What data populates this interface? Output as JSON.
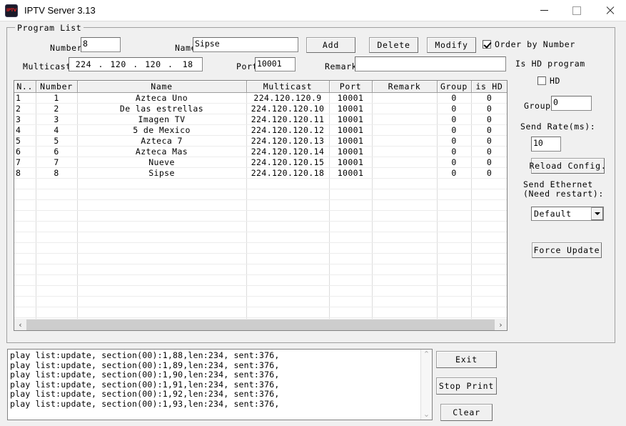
{
  "window": {
    "title": "IPTV Server 3.13",
    "icon": "iptv-logo-icon",
    "icon_text": "IPTV",
    "minimize": "—",
    "maximize": "□",
    "close": "✕"
  },
  "group": {
    "title": "Program List"
  },
  "form": {
    "number_label": "Number",
    "number_value": "8",
    "name_label": "Name",
    "name_value": "Sipse",
    "multicast_label": "Multicast",
    "multicast_octets": [
      "224",
      "120",
      "120",
      "18"
    ],
    "multicast_sep": ".",
    "port_label": "Port",
    "port_value": "10001",
    "remark_label": "Remark",
    "remark_value": ""
  },
  "actions": {
    "add": "Add",
    "delete": "Delete",
    "modify": "Modify",
    "order_by_number": "Order by Number",
    "order_by_number_checked": true
  },
  "hd_panel": {
    "title": "Is HD program",
    "hd_label": "HD",
    "hd_checked": false,
    "group_label": "Group",
    "group_value": "0"
  },
  "send_panel": {
    "rate_label": "Send Rate(ms):",
    "rate_value": "10",
    "reload_button": "Reload Config.",
    "ethernet_label_line1": "Send Ethernet",
    "ethernet_label_line2": "(Need restart):",
    "ethernet_value": "Default",
    "ethernet_options": [
      "Default"
    ],
    "force_update_button": "Force Update"
  },
  "table": {
    "columns": [
      "N..",
      "Number",
      "Name",
      "Multicast",
      "Port",
      "Remark",
      "Group",
      "is HD"
    ],
    "rows": [
      {
        "n": "1",
        "number": "1",
        "name": "Azteca Uno",
        "multicast": "224.120.120.9",
        "port": "10001",
        "remark": "",
        "group": "0",
        "is_hd": "0"
      },
      {
        "n": "2",
        "number": "2",
        "name": "De las estrellas",
        "multicast": "224.120.120.10",
        "port": "10001",
        "remark": "",
        "group": "0",
        "is_hd": "0"
      },
      {
        "n": "3",
        "number": "3",
        "name": "Imagen TV",
        "multicast": "224.120.120.11",
        "port": "10001",
        "remark": "",
        "group": "0",
        "is_hd": "0"
      },
      {
        "n": "4",
        "number": "4",
        "name": "5 de Mexico",
        "multicast": "224.120.120.12",
        "port": "10001",
        "remark": "",
        "group": "0",
        "is_hd": "0"
      },
      {
        "n": "5",
        "number": "5",
        "name": "Azteca 7",
        "multicast": "224.120.120.13",
        "port": "10001",
        "remark": "",
        "group": "0",
        "is_hd": "0"
      },
      {
        "n": "6",
        "number": "6",
        "name": "Azteca Mas",
        "multicast": "224.120.120.14",
        "port": "10001",
        "remark": "",
        "group": "0",
        "is_hd": "0"
      },
      {
        "n": "7",
        "number": "7",
        "name": "Nueve",
        "multicast": "224.120.120.15",
        "port": "10001",
        "remark": "",
        "group": "0",
        "is_hd": "0"
      },
      {
        "n": "8",
        "number": "8",
        "name": "Sipse",
        "multicast": "224.120.120.18",
        "port": "10001",
        "remark": "",
        "group": "0",
        "is_hd": "0"
      }
    ],
    "empty_row_count": 16,
    "scroll_left_arrow": "‹",
    "scroll_right_arrow": "›"
  },
  "log": {
    "lines": [
      "play list:update, section(00):1,88,len:234, sent:376,",
      "play list:update, section(00):1,89,len:234, sent:376,",
      "play list:update, section(00):1,90,len:234, sent:376,",
      "play list:update, section(00):1,91,len:234, sent:376,",
      "play list:update, section(00):1,92,len:234, sent:376,",
      "play list:update, section(00):1,93,len:234, sent:376,"
    ],
    "scroll_up_arrow": "⌃",
    "scroll_down_arrow": "⌄"
  },
  "bottom_buttons": {
    "exit": "Exit",
    "stop_print": "Stop Print",
    "clear": "Clear"
  }
}
